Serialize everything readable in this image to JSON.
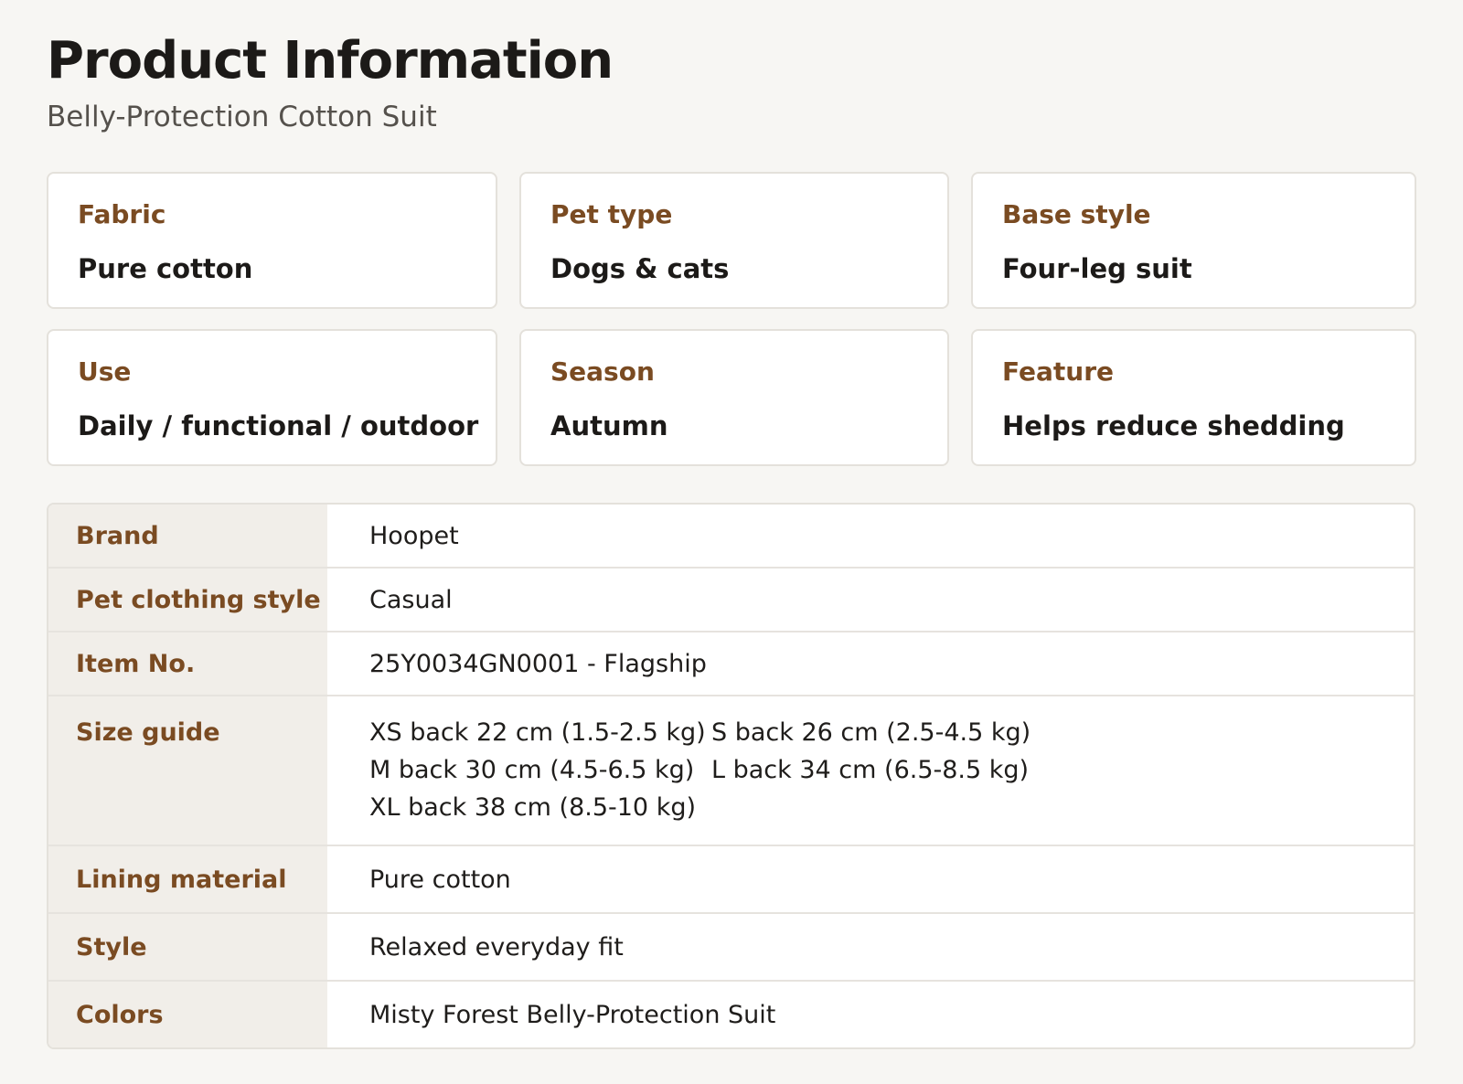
{
  "header": {
    "title": "Product Information",
    "subtitle": "Belly-Protection Cotton Suit"
  },
  "cards": [
    {
      "label": "Fabric",
      "value": "Pure cotton"
    },
    {
      "label": "Pet type",
      "value": "Dogs & cats"
    },
    {
      "label": "Base style",
      "value": "Four-leg suit"
    },
    {
      "label": "Use",
      "value": "Daily / functional / outdoor"
    },
    {
      "label": "Season",
      "value": "Autumn"
    },
    {
      "label": "Feature",
      "value": "Helps reduce shedding"
    }
  ],
  "specs": {
    "brand": {
      "label": "Brand",
      "value": "Hoopet"
    },
    "clothing_style": {
      "label": "Pet clothing style",
      "value": "Casual"
    },
    "item_no": {
      "label": "Item No.",
      "value": "25Y0034GN0001 - Flagship"
    },
    "size_guide": {
      "label": "Size guide",
      "sizes": [
        "XS back 22 cm (1.5-2.5 kg)",
        "S back 26 cm (2.5-4.5 kg)",
        "M back 30 cm (4.5-6.5 kg)",
        "L back 34 cm (6.5-8.5 kg)",
        "XL back 38 cm (8.5-10 kg)"
      ]
    },
    "lining": {
      "label": "Lining material",
      "value": "Pure cotton"
    },
    "style": {
      "label": "Style",
      "value": "Relaxed everyday fit"
    },
    "colors": {
      "label": "Colors",
      "value": "Misty Forest Belly-Protection Suit"
    }
  },
  "theme": {
    "accent": "#7a4b22",
    "background": "#f7f6f3",
    "label_column_bg": "#f1eee9",
    "border": "#e4e1db"
  }
}
